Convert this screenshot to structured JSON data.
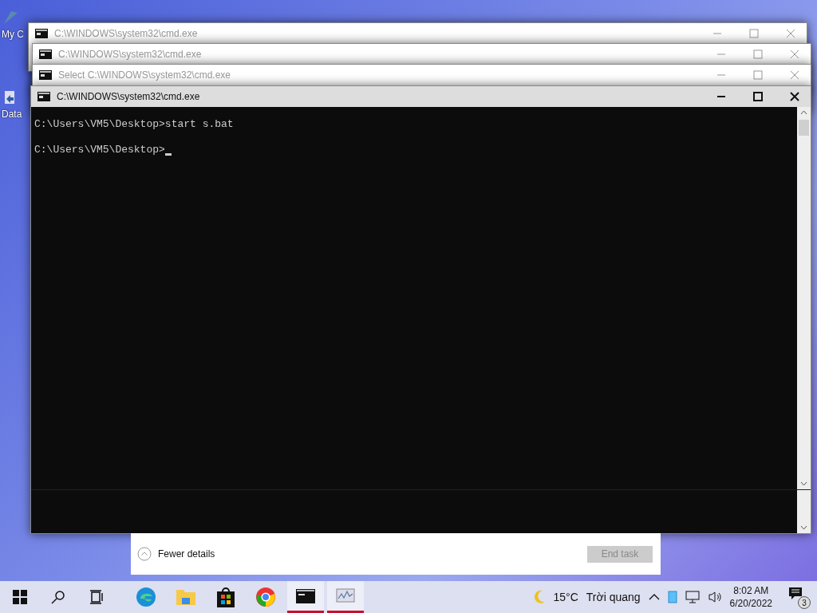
{
  "desktop_icons": [
    {
      "label": "My C"
    },
    {
      "label": "Data"
    }
  ],
  "windows": [
    {
      "title": "C:\\WINDOWS\\system32\\cmd.exe",
      "active": false
    },
    {
      "title": "C:\\WINDOWS\\system32\\cmd.exe",
      "active": false
    },
    {
      "title": "Select C:\\WINDOWS\\system32\\cmd.exe",
      "active": false
    },
    {
      "title": "C:\\WINDOWS\\system32\\cmd.exe",
      "active": true,
      "lines": [
        "C:\\Users\\VM5\\Desktop>start s.bat",
        "C:\\Users\\VM5\\Desktop>"
      ]
    }
  ],
  "task_manager": {
    "toggle": "Fewer details",
    "end_task": {
      "label": "End task",
      "disabled": true
    }
  },
  "taskbar": {
    "apps": [
      {
        "kind": "edge",
        "running": false
      },
      {
        "kind": "explorer",
        "running": false
      },
      {
        "kind": "store",
        "running": false
      },
      {
        "kind": "chrome",
        "running": false
      },
      {
        "kind": "console",
        "running": true
      },
      {
        "kind": "monitor",
        "running": true
      }
    ],
    "weather": {
      "temperature": "15°C",
      "condition": "Trời quang"
    },
    "clock": {
      "time": "8:02 AM",
      "date": "6/20/2022"
    },
    "notifications": {
      "count": "3"
    }
  }
}
